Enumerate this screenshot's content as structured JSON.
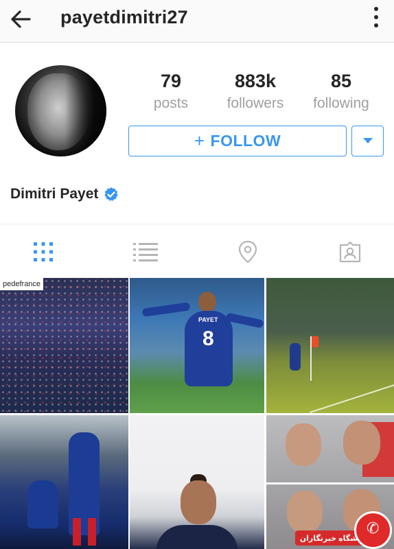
{
  "header": {
    "username": "payetdimitri27"
  },
  "profile": {
    "full_name": "Dimitri Payet",
    "verified": true,
    "stats": [
      {
        "value": "79",
        "label": "posts"
      },
      {
        "value": "883k",
        "label": "followers"
      },
      {
        "value": "85",
        "label": "following"
      }
    ],
    "follow_label": "FOLLOW",
    "accent_color": "#3897f0"
  },
  "tabs": {
    "active": "grid",
    "items": [
      "grid-icon",
      "list-icon",
      "location-pin-icon",
      "tagged-icon"
    ]
  },
  "grid": {
    "first_caption": "pedefrance",
    "player_name": "PAYET",
    "player_number": "8"
  },
  "watermark": {
    "text": "باشگاه خبرنگاران"
  }
}
